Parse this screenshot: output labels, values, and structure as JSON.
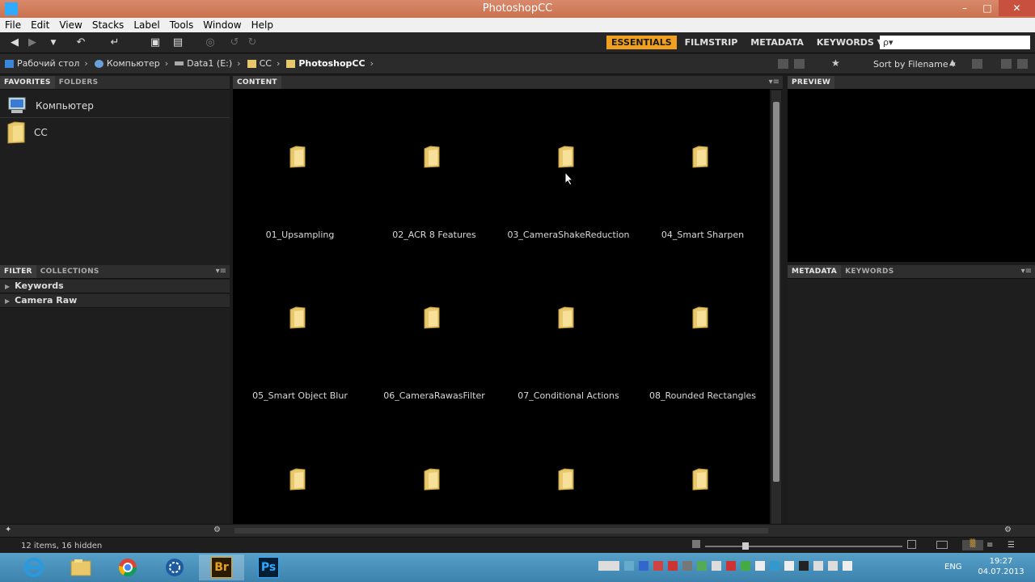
{
  "window": {
    "title": "PhotoshopCC"
  },
  "menu": [
    "File",
    "Edit",
    "View",
    "Stacks",
    "Label",
    "Tools",
    "Window",
    "Help"
  ],
  "workspaces": [
    {
      "label": "ESSENTIALS",
      "active": true
    },
    {
      "label": "FILMSTRIP",
      "active": false
    },
    {
      "label": "METADATA",
      "active": false
    },
    {
      "label": "KEYWORDS ▼",
      "active": false
    }
  ],
  "search": {
    "placeholder": "ρ▾"
  },
  "breadcrumbs": [
    {
      "label": "Рабочий стол",
      "icon": "desktop-icon"
    },
    {
      "label": "Компьютер",
      "icon": "computer-icon"
    },
    {
      "label": "Data1 (E:)",
      "icon": "drive-icon"
    },
    {
      "label": "CC",
      "icon": "folder-icon"
    },
    {
      "label": "PhotoshopCC",
      "icon": "folder-icon"
    }
  ],
  "sort": {
    "label": "Sort by Filename ▾"
  },
  "left_top_panel": {
    "tabs": [
      "FAVORITES",
      "FOLDERS"
    ],
    "items": [
      {
        "label": "Компьютер",
        "icon": "computer-icon"
      },
      {
        "label": "CC",
        "icon": "folder-icon"
      }
    ]
  },
  "left_bottom_panel": {
    "tabs": [
      "FILTER",
      "COLLECTIONS"
    ],
    "rows": [
      "Keywords",
      "Camera Raw"
    ]
  },
  "content_panel": {
    "tab": "CONTENT",
    "items": [
      "01_Upsampling",
      "02_ACR 8 Features",
      "03_CameraShakeReduction",
      "04_Smart Sharpen",
      "05_Smart Object Blur",
      "06_CameraRawasFilter",
      "07_Conditional Actions",
      "08_Rounded Rectangles",
      "",
      "",
      "",
      ""
    ]
  },
  "preview_panel": {
    "tab": "PREVIEW"
  },
  "metadata_panel": {
    "tabs": [
      "METADATA",
      "KEYWORDS"
    ]
  },
  "status": {
    "text": "12 items, 16 hidden"
  },
  "taskbar": {
    "apps": [
      "ie-icon",
      "explorer-icon",
      "chrome-icon",
      "app-icon",
      "bridge-icon",
      "photoshop-icon"
    ],
    "bridge_label": "Br",
    "photoshop_label": "Ps",
    "lang": "ENG",
    "time": "19:27",
    "date": "04.07.2013"
  },
  "colors": {
    "accent": "#f0a020",
    "folder": "#e8c86a",
    "titlebar": "#c9714f",
    "taskbar": "#3c82ad"
  }
}
